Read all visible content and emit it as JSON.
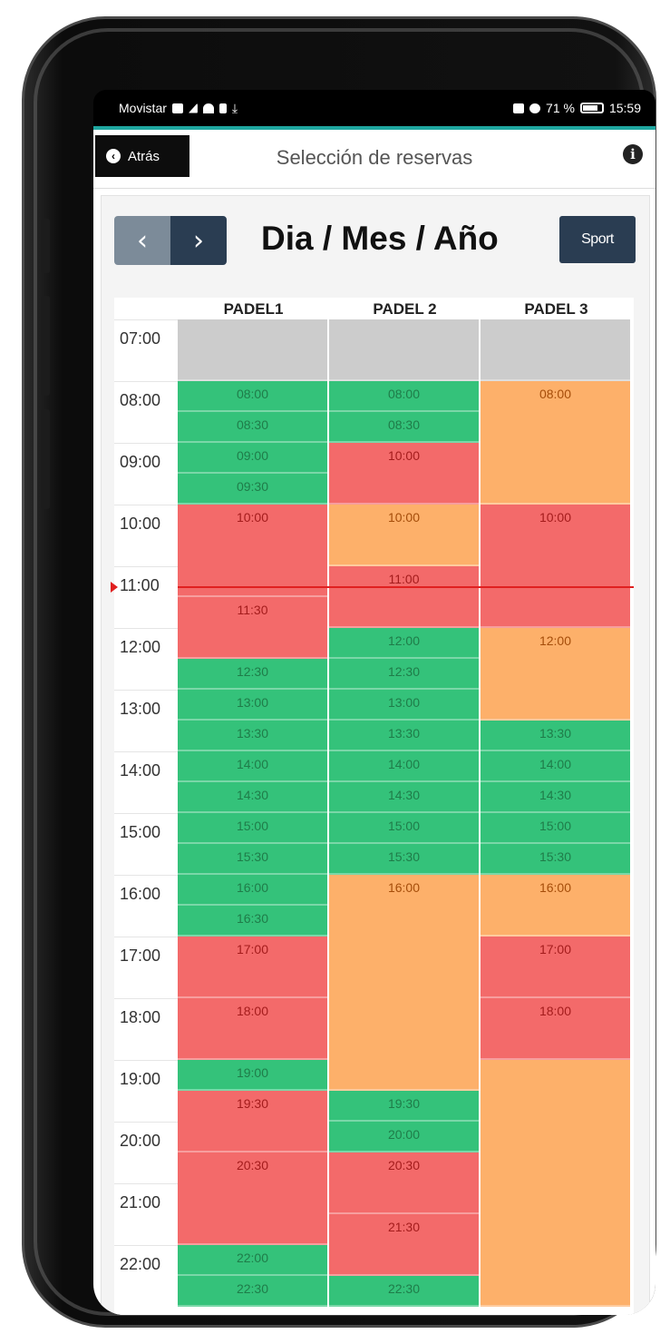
{
  "status_bar": {
    "carrier": "Movistar",
    "battery": "71 %",
    "time": "15:59"
  },
  "header": {
    "back_label": "Atrás",
    "title": "Selección de reservas",
    "info_icon": "info-icon"
  },
  "toolbar": {
    "prev_label": "‹",
    "next_label": "›",
    "date_label": "Dia / Mes / Año",
    "sport_label": "Sport"
  },
  "colors": {
    "free": "#34c27a",
    "busy": "#f36a6a",
    "pending": "#fdb06a",
    "closed": "#cccccc",
    "now_line": "#e02020"
  },
  "schedule": {
    "start_hour": "07:00",
    "hours": [
      "07:00",
      "08:00",
      "09:00",
      "10:00",
      "11:00",
      "12:00",
      "13:00",
      "14:00",
      "15:00",
      "16:00",
      "17:00",
      "18:00",
      "19:00",
      "20:00",
      "21:00",
      "22:00"
    ],
    "courts": [
      {
        "name": "PADEL1",
        "slots": [
          {
            "label": "",
            "status": "closed",
            "start": "07:00",
            "end": "08:00"
          },
          {
            "label": "08:00",
            "status": "free",
            "start": "08:00",
            "end": "08:30"
          },
          {
            "label": "08:30",
            "status": "free",
            "start": "08:30",
            "end": "09:00"
          },
          {
            "label": "09:00",
            "status": "free",
            "start": "09:00",
            "end": "09:30"
          },
          {
            "label": "09:30",
            "status": "free",
            "start": "09:30",
            "end": "10:00"
          },
          {
            "label": "10:00",
            "status": "busy",
            "start": "10:00",
            "end": "11:30"
          },
          {
            "label": "11:30",
            "status": "busy",
            "start": "11:30",
            "end": "12:30"
          },
          {
            "label": "12:30",
            "status": "free",
            "start": "12:30",
            "end": "13:00"
          },
          {
            "label": "13:00",
            "status": "free",
            "start": "13:00",
            "end": "13:30"
          },
          {
            "label": "13:30",
            "status": "free",
            "start": "13:30",
            "end": "14:00"
          },
          {
            "label": "14:00",
            "status": "free",
            "start": "14:00",
            "end": "14:30"
          },
          {
            "label": "14:30",
            "status": "free",
            "start": "14:30",
            "end": "15:00"
          },
          {
            "label": "15:00",
            "status": "free",
            "start": "15:00",
            "end": "15:30"
          },
          {
            "label": "15:30",
            "status": "free",
            "start": "15:30",
            "end": "16:00"
          },
          {
            "label": "16:00",
            "status": "free",
            "start": "16:00",
            "end": "16:30"
          },
          {
            "label": "16:30",
            "status": "free",
            "start": "16:30",
            "end": "17:00"
          },
          {
            "label": "17:00",
            "status": "busy",
            "start": "17:00",
            "end": "18:00"
          },
          {
            "label": "18:00",
            "status": "busy",
            "start": "18:00",
            "end": "19:00"
          },
          {
            "label": "19:00",
            "status": "free",
            "start": "19:00",
            "end": "19:30"
          },
          {
            "label": "19:30",
            "status": "busy",
            "start": "19:30",
            "end": "20:30"
          },
          {
            "label": "20:30",
            "status": "busy",
            "start": "20:30",
            "end": "22:00"
          },
          {
            "label": "22:00",
            "status": "free",
            "start": "22:00",
            "end": "22:30"
          },
          {
            "label": "22:30",
            "status": "free",
            "start": "22:30",
            "end": "23:00"
          }
        ]
      },
      {
        "name": "PADEL 2",
        "slots": [
          {
            "label": "",
            "status": "closed",
            "start": "07:00",
            "end": "08:00"
          },
          {
            "label": "08:00",
            "status": "free",
            "start": "08:00",
            "end": "08:30"
          },
          {
            "label": "08:30",
            "status": "free",
            "start": "08:30",
            "end": "09:00"
          },
          {
            "label": "10:00",
            "status": "busy",
            "start": "09:00",
            "end": "10:00"
          },
          {
            "label": "10:00",
            "status": "pending",
            "start": "10:00",
            "end": "11:00"
          },
          {
            "label": "11:00",
            "status": "busy",
            "start": "11:00",
            "end": "12:00"
          },
          {
            "label": "12:00",
            "status": "free",
            "start": "12:00",
            "end": "12:30"
          },
          {
            "label": "12:30",
            "status": "free",
            "start": "12:30",
            "end": "13:00"
          },
          {
            "label": "13:00",
            "status": "free",
            "start": "13:00",
            "end": "13:30"
          },
          {
            "label": "13:30",
            "status": "free",
            "start": "13:30",
            "end": "14:00"
          },
          {
            "label": "14:00",
            "status": "free",
            "start": "14:00",
            "end": "14:30"
          },
          {
            "label": "14:30",
            "status": "free",
            "start": "14:30",
            "end": "15:00"
          },
          {
            "label": "15:00",
            "status": "free",
            "start": "15:00",
            "end": "15:30"
          },
          {
            "label": "15:30",
            "status": "free",
            "start": "15:30",
            "end": "16:00"
          },
          {
            "label": "16:00",
            "status": "pending",
            "start": "16:00",
            "end": "19:30"
          },
          {
            "label": "19:30",
            "status": "free",
            "start": "19:30",
            "end": "20:00"
          },
          {
            "label": "20:00",
            "status": "free",
            "start": "20:00",
            "end": "20:30"
          },
          {
            "label": "20:30",
            "status": "busy",
            "start": "20:30",
            "end": "21:30"
          },
          {
            "label": "21:30",
            "status": "busy",
            "start": "21:30",
            "end": "22:30"
          },
          {
            "label": "22:30",
            "status": "free",
            "start": "22:30",
            "end": "23:00"
          }
        ]
      },
      {
        "name": "PADEL 3",
        "slots": [
          {
            "label": "",
            "status": "closed",
            "start": "07:00",
            "end": "08:00"
          },
          {
            "label": "08:00",
            "status": "pending",
            "start": "08:00",
            "end": "10:00"
          },
          {
            "label": "10:00",
            "status": "busy",
            "start": "10:00",
            "end": "12:00"
          },
          {
            "label": "12:00",
            "status": "pending",
            "start": "12:00",
            "end": "13:30"
          },
          {
            "label": "13:30",
            "status": "free",
            "start": "13:30",
            "end": "14:00"
          },
          {
            "label": "14:00",
            "status": "free",
            "start": "14:00",
            "end": "14:30"
          },
          {
            "label": "14:30",
            "status": "free",
            "start": "14:30",
            "end": "15:00"
          },
          {
            "label": "15:00",
            "status": "free",
            "start": "15:00",
            "end": "15:30"
          },
          {
            "label": "15:30",
            "status": "free",
            "start": "15:30",
            "end": "16:00"
          },
          {
            "label": "16:00",
            "status": "pending",
            "start": "16:00",
            "end": "17:00"
          },
          {
            "label": "17:00",
            "status": "busy",
            "start": "17:00",
            "end": "18:00"
          },
          {
            "label": "18:00",
            "status": "busy",
            "start": "18:00",
            "end": "19:00"
          },
          {
            "label": "",
            "status": "pending",
            "start": "19:00",
            "end": "23:00"
          }
        ]
      }
    ],
    "current_time": "11:30"
  }
}
